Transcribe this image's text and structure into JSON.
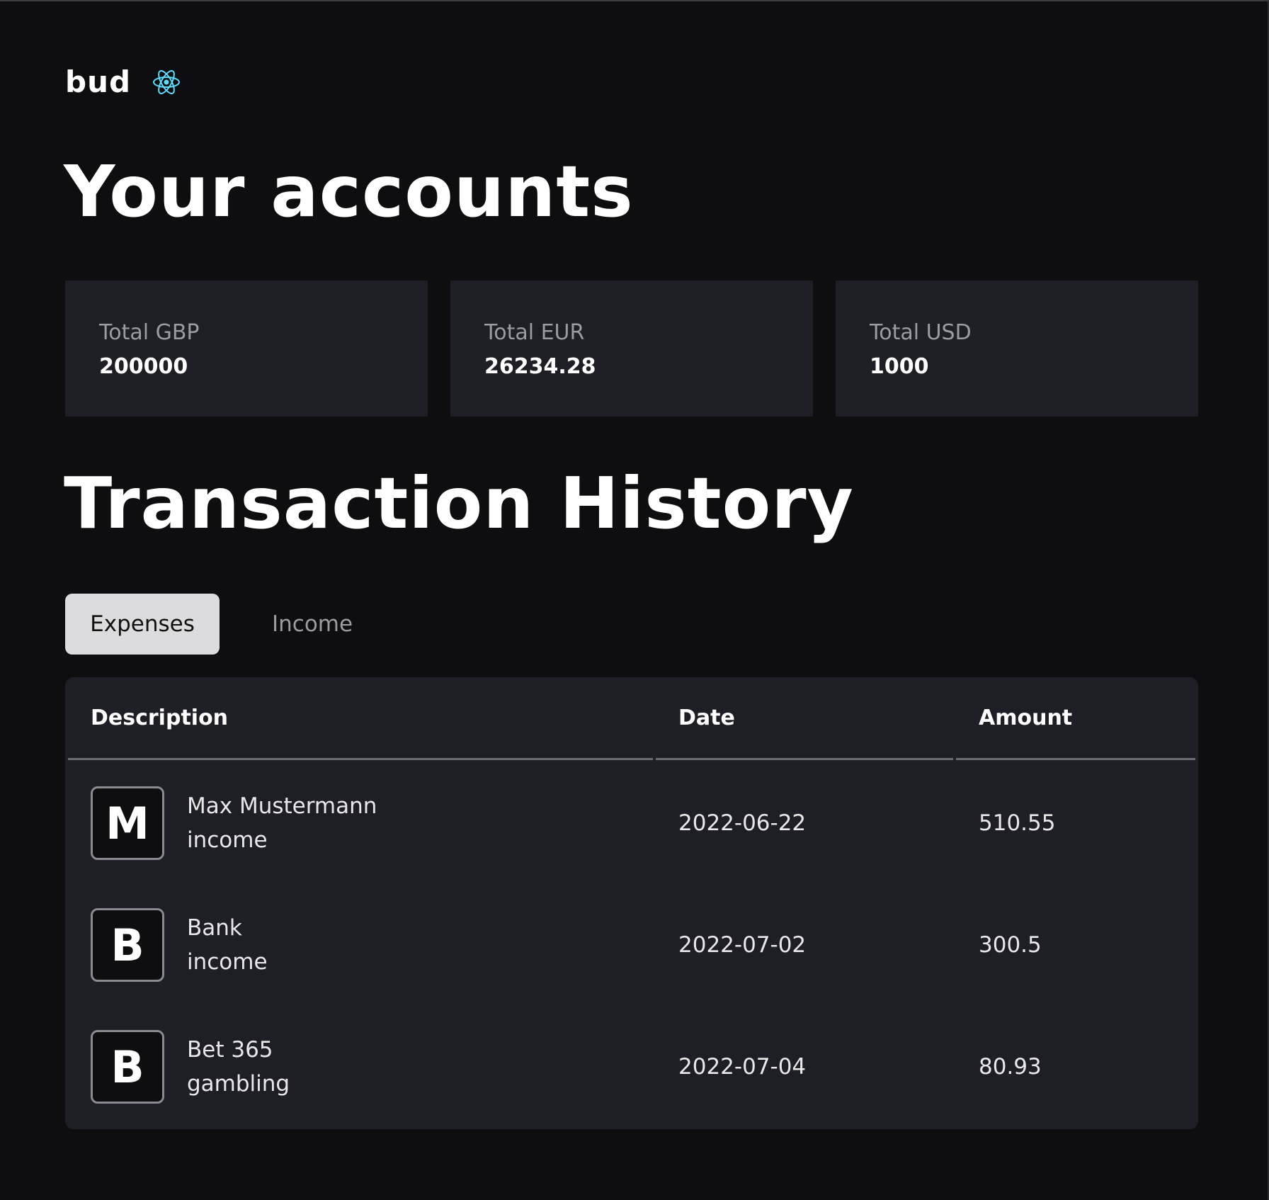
{
  "brand": {
    "name": "bud",
    "icon": "react-icon",
    "icon_color": "#61dafb"
  },
  "headings": {
    "accounts": "Your accounts",
    "history": "Transaction History"
  },
  "accounts": [
    {
      "label": "Total GBP",
      "value": "200000"
    },
    {
      "label": "Total EUR",
      "value": "26234.28"
    },
    {
      "label": "Total USD",
      "value": "1000"
    }
  ],
  "tabs": [
    {
      "label": "Expenses",
      "active": true
    },
    {
      "label": "Income",
      "active": false
    }
  ],
  "table": {
    "columns": [
      "Description",
      "Date",
      "Amount"
    ],
    "rows": [
      {
        "initial": "M",
        "name": "Max Mustermann",
        "category": "income",
        "date": "2022-06-22",
        "amount": "510.55"
      },
      {
        "initial": "B",
        "name": "Bank",
        "category": "income",
        "date": "2022-07-02",
        "amount": "300.5"
      },
      {
        "initial": "B",
        "name": "Bet 365",
        "category": "gambling",
        "date": "2022-07-04",
        "amount": "80.93"
      }
    ]
  },
  "colors": {
    "background": "#0e0e10",
    "card": "#1e1f26",
    "muted_text": "#9a9ba3",
    "active_tab": "#dcdcdf"
  }
}
